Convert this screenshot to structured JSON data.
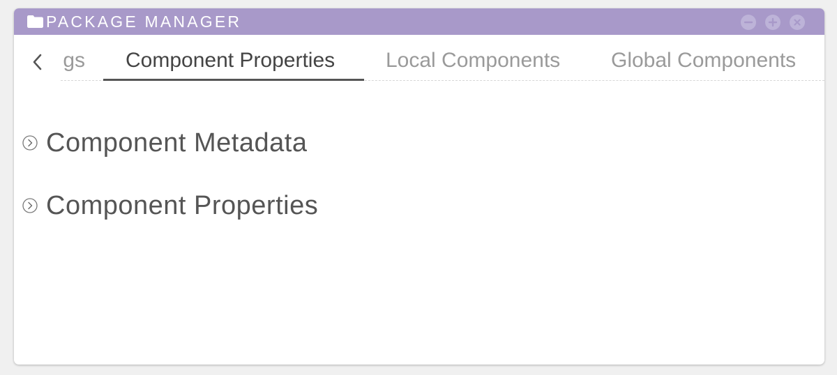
{
  "window": {
    "title": "PACKAGE MANAGER",
    "title_icon": "folder-icon",
    "controls": {
      "minimize_icon": "minus-icon",
      "maximize_icon": "plus-icon",
      "close_icon": "close-icon"
    }
  },
  "tabs": {
    "scroll_back_icon": "chevron-left-icon",
    "items": [
      {
        "label": "gs",
        "clipped": true,
        "active": false
      },
      {
        "label": "Component Properties",
        "active": true
      },
      {
        "label": "Local Components",
        "active": false
      },
      {
        "label": "Global Components",
        "active": false
      }
    ]
  },
  "sections": [
    {
      "label": "Component Metadata",
      "expanded": false,
      "icon": "chevron-right-circle-icon"
    },
    {
      "label": "Component Properties",
      "expanded": false,
      "icon": "chevron-right-circle-icon"
    }
  ],
  "colors": {
    "titlebar": "#a899c9",
    "active_tab": "#444444",
    "inactive_tab": "#9a9a9a",
    "section_text": "#555555"
  }
}
